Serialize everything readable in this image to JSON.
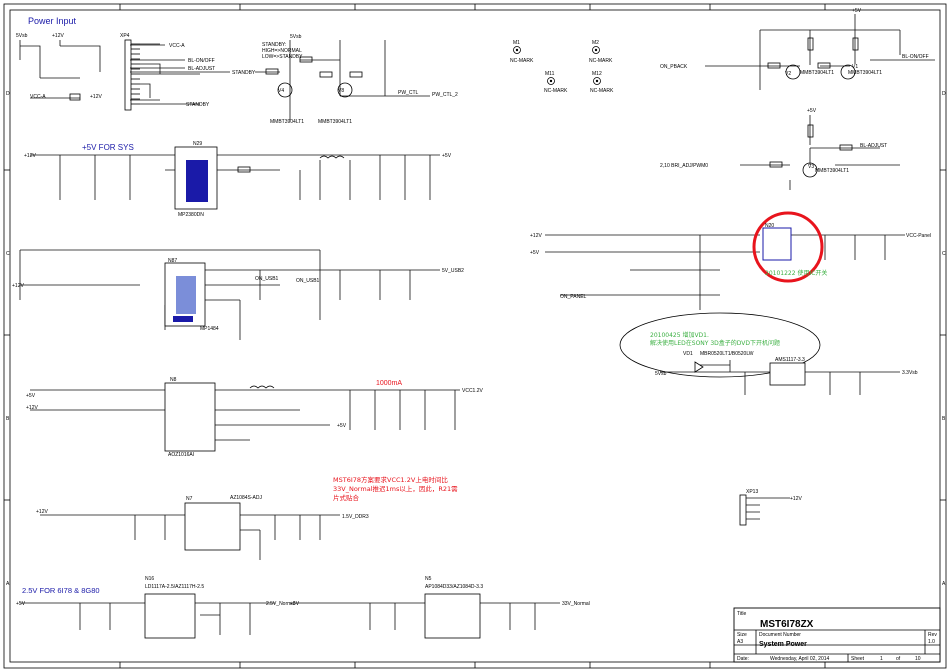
{
  "title": "Power Input",
  "section_5v_sys": "+5V FOR SYS",
  "section_25v": "2.5V FOR 6I78 & 8G80",
  "current_note": "1000mA",
  "note_cn": [
    "MST6I78方案要求VCC1.2V上电时间比",
    "33V_Normal推迟1ms以上，因此，R21需",
    "片式贴合"
  ],
  "note_mode": [
    "STANDBY:",
    "HIGH=>NORMAL",
    "LOW=>STANDBY"
  ],
  "annot_20101222": "20101222 使用IC开关",
  "annot_20100425": [
    "20100425 增加VD1.",
    "解决使用LED在SONY 3D盒子的DVD下开机问题"
  ],
  "nets": {
    "vcc_a": "VCC-A",
    "bl_onoff": "BL-ON/OFF",
    "bl_adjust": "BL-ADJUST",
    "standby": "STANDBY",
    "5vsb": "5Vsb",
    "pw_ctl": "PW_CTL",
    "pw_ctl_2": "PW_CTL_2",
    "on_pback": "ON_PBACK",
    "bl_on_off": "BL-ON/OFF",
    "bl_adjust2": "BL-ADJUST",
    "bri_adj": "2,10 BRI_ADJ/PWM0",
    "vcc_panel": "VCC-Panel",
    "on_panel": "ON_PANEL",
    "p5v": "+5V",
    "p12v": "+12V",
    "vcc12": "VCC1.2V",
    "v15_ddr3": "1.5V_DDR3",
    "v25_normal": "2.5V_Normal",
    "v33_normal": "33V_Normal",
    "v33vsb": "3.3Vsb",
    "v5v_usb2": "5V_USB2",
    "on_usb1": "ON_USB1",
    "on_usb1b": "ON_USB1"
  },
  "components": {
    "xp4": "XP4",
    "xp13": "XP13",
    "n29": "N29",
    "n29_part": "MP2380DN",
    "n87": "N87",
    "n87_part": "MP1484",
    "n8": "N8",
    "n8_part": "AOZ1016AI",
    "n7": "N7",
    "n7_part": "AZ1084S-ADJ",
    "n16": "N16",
    "n16_part": "LD1117A-2.5/AZ1117H-2.5",
    "n5": "N5",
    "n5_part": "AP1084D33/AZ1084D-3.3",
    "n20": "N20",
    "n20_part": "AMS1117-3.3",
    "v4": "V4",
    "v8": "V8",
    "v1": "V1",
    "v2": "V2",
    "v3": "V3",
    "vd1": "VD1",
    "vd1_part": "MBR0520LT1/B0520LW",
    "mmbt": "MMBT3904LT1",
    "m1": "M1",
    "m2": "M2",
    "m11": "M11",
    "m12": "M12",
    "nc_mark": "NC-MARK"
  },
  "titleblock": {
    "title_label": "Title",
    "title": "MST6I78ZX",
    "size_label": "Size",
    "size": "A3",
    "docnum_label": "Document Number",
    "docnum": "System Power",
    "rev_label": "Rev",
    "rev": "1.0",
    "date_label": "Date:",
    "date": "Wednesday, April 02, 2014",
    "sheet_label": "Sheet",
    "sheet": "1",
    "of_label": "of",
    "of": "10"
  },
  "border": {
    "cols": [
      "1",
      "2",
      "3",
      "4",
      "5",
      "6",
      "7",
      "8"
    ],
    "rows": [
      "A",
      "B",
      "C",
      "D"
    ]
  }
}
